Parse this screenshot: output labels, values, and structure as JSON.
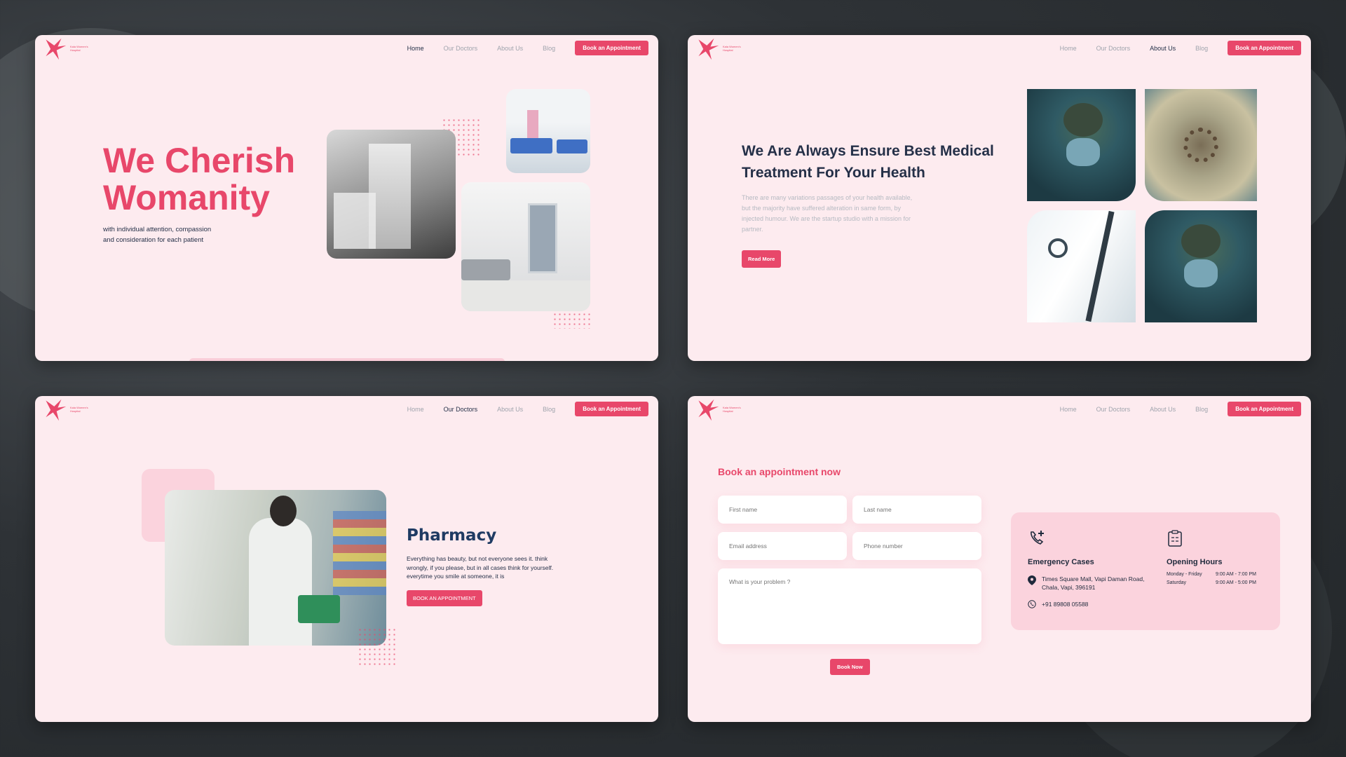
{
  "brand": {
    "name": "Kala Women's Hospital",
    "color": "#e8476a"
  },
  "nav": {
    "links": [
      "Home",
      "Our Doctors",
      "About Us",
      "Blog"
    ],
    "cta": "Book an Appointment"
  },
  "pages": [
    {
      "id": "home",
      "active_nav": "Home"
    },
    {
      "id": "about",
      "active_nav": "About Us"
    },
    {
      "id": "doctors",
      "active_nav": "Our Doctors"
    },
    {
      "id": "appointment",
      "active_nav": "None"
    }
  ],
  "hero": {
    "title_line1": "We Cherish",
    "title_line2": "Womanity",
    "subtitle": "with individual attention, compassion and consideration for each patient"
  },
  "about": {
    "title": "We Are Always Ensure Best Medical Treatment For Your Health",
    "body": "There are many variations passages of your health available, but the majority have suffered alteration in same form, by injected humour. We are the startup studio with a mission for partner.",
    "button": "Read More"
  },
  "pharmacy": {
    "title": "Pharmacy",
    "body": "Everything has beauty, but not everyone sees it. think wrongly, if you please, but in all cases think for yourself. everytime you smile at someone, it is",
    "button": "BOOK AN APPOINTMENT"
  },
  "booking": {
    "title": "Book an appointment now",
    "placeholders": {
      "first_name": "First name",
      "last_name": "Last name",
      "email": "Email address",
      "phone": "Phone number",
      "problem": "What is your problem ?"
    },
    "submit": "Book Now"
  },
  "contact": {
    "emergency_title": "Emergency Cases",
    "address": "Times Square Mall, Vapi Daman Road, Chala, Vapi, 396191",
    "phone": "+91 89808 05588",
    "hours_title": "Opening Hours",
    "hours": [
      {
        "days": "Monday - Friday",
        "time": "9:00 AM - 7:00 PM"
      },
      {
        "days": "Saturday",
        "time": "9:00 AM - 5:00 PM"
      }
    ]
  },
  "icons": [
    "bird-logo-icon",
    "phone-plus-icon",
    "calendar-icon",
    "location-pin-icon",
    "phone-circle-icon"
  ]
}
